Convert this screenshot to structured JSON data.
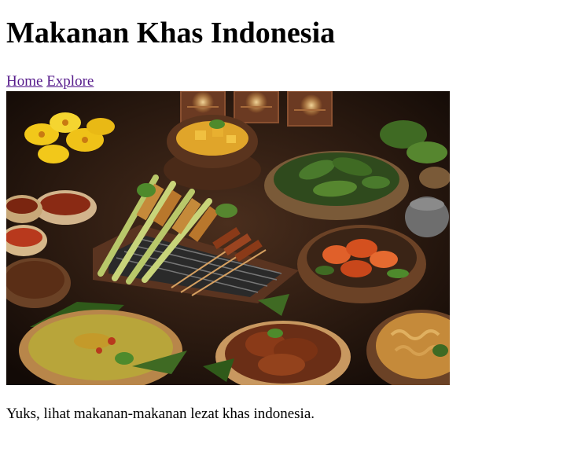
{
  "page": {
    "title": "Makanan Khas Indonesia",
    "caption": "Yuks, lihat makanan-makanan lezat khas indonesia."
  },
  "nav": {
    "links": [
      {
        "label": "Home"
      },
      {
        "label": "Explore"
      }
    ],
    "link_color": "#551a8b"
  },
  "hero_image": {
    "icon": "indonesian-food-spread-photo",
    "colors": {
      "background": "#1a0f0a",
      "table_wood": "#3a2418",
      "frangipani": "#f2c81a",
      "sauce_red": "#b8391d",
      "leaf_green": "#3f6a23",
      "rice_yellow": "#d8b83a",
      "candle": "#ffd58a"
    }
  }
}
